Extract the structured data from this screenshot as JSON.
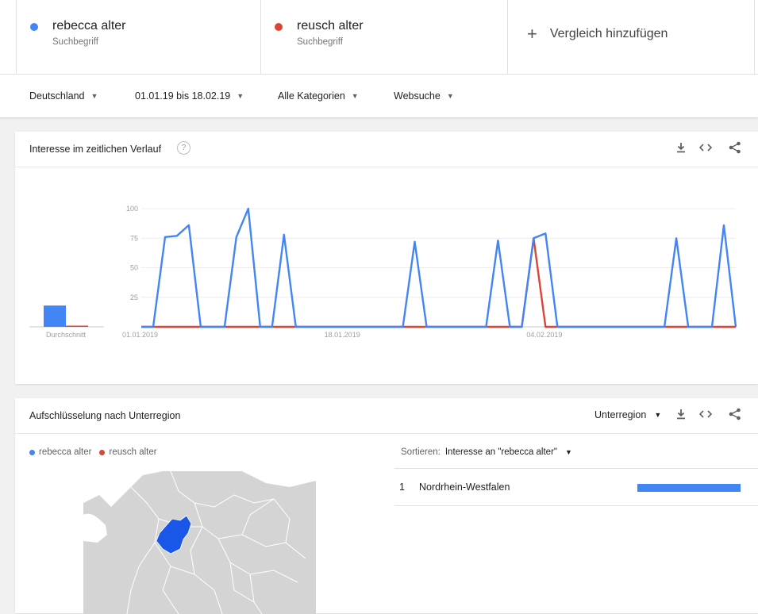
{
  "colors": {
    "term1": "#4285f4",
    "term2": "#db4437",
    "map_land": "#d4d4d4",
    "map_highlight": "#1a56e8"
  },
  "compare": {
    "terms": [
      {
        "name": "rebecca alter",
        "sub": "Suchbegriff"
      },
      {
        "name": "reusch alter",
        "sub": "Suchbegriff"
      }
    ],
    "add_label": "Vergleich hinzufügen",
    "add_icon": "plus-icon"
  },
  "filters": {
    "country": "Deutschland",
    "daterange": "01.01.19 bis 18.02.19",
    "category": "Alle Kategorien",
    "search_type": "Websuche"
  },
  "interest_card": {
    "title": "Interesse im zeitlichen Verlauf",
    "help_icon": "?",
    "icons": [
      "download-icon",
      "embed-icon",
      "share-icon"
    ],
    "average_label": "Durchschnitt"
  },
  "chart_data": {
    "type": "line",
    "xlabel": "",
    "ylabel": "",
    "ylim": [
      0,
      100
    ],
    "yticks": [
      25,
      50,
      75,
      100
    ],
    "x_tick_labels": [
      {
        "day": 0,
        "label": "01.01.2019"
      },
      {
        "day": 17,
        "label": "18.01.2019"
      },
      {
        "day": 34,
        "label": "04.02.2019"
      }
    ],
    "days": 49,
    "series": [
      {
        "values": [
          0,
          0,
          76,
          77,
          86,
          0,
          0,
          0,
          76,
          100,
          0,
          0,
          78,
          0,
          0,
          0,
          0,
          0,
          0,
          0,
          0,
          0,
          0,
          72,
          0,
          0,
          0,
          0,
          0,
          0,
          73,
          0,
          0,
          75,
          79,
          0,
          0,
          0,
          0,
          0,
          0,
          0,
          0,
          0,
          0,
          75,
          0,
          0,
          0,
          86,
          0
        ]
      },
      {
        "values": [
          0,
          0,
          0,
          0,
          0,
          0,
          0,
          0,
          0,
          0,
          0,
          0,
          0,
          0,
          0,
          0,
          0,
          0,
          0,
          0,
          0,
          0,
          0,
          0,
          0,
          0,
          0,
          0,
          0,
          0,
          0,
          0,
          0,
          75,
          0,
          0,
          0,
          0,
          0,
          0,
          0,
          0,
          0,
          0,
          0,
          0,
          0,
          0,
          0,
          0,
          0
        ]
      }
    ],
    "averages": [
      18,
      1
    ]
  },
  "region_card": {
    "title": "Aufschlüsselung nach Unterregion",
    "level_select": "Unterregion",
    "icons": [
      "download-icon",
      "embed-icon",
      "share-icon"
    ],
    "legend": [
      "rebecca alter",
      "reusch alter"
    ],
    "sort_label": "Sortieren:",
    "sort_value": "Interesse an \"rebecca alter\"",
    "rows": [
      {
        "rank": "1",
        "name": "Nordrhein-Westfalen",
        "value": 100
      }
    ]
  }
}
